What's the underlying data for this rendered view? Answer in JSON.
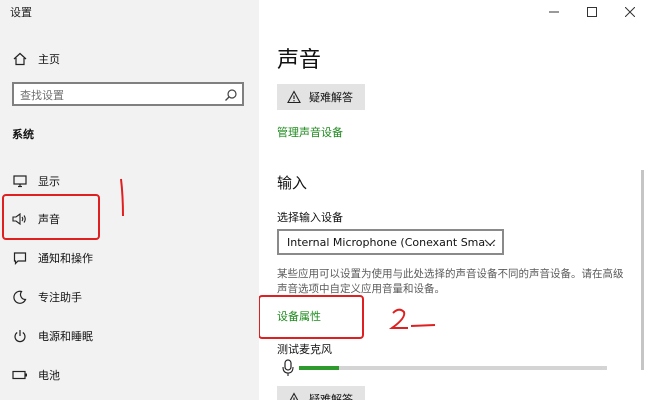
{
  "window": {
    "title": "设置",
    "controls": {
      "minimize": "—",
      "maximize": "□",
      "close": "✕"
    }
  },
  "sidebar": {
    "home_label": "主页",
    "search_placeholder": "查找设置",
    "section": "系统",
    "items": [
      {
        "label": "显示",
        "icon": "monitor-icon"
      },
      {
        "label": "声音",
        "icon": "speaker-icon"
      },
      {
        "label": "通知和操作",
        "icon": "notification-icon"
      },
      {
        "label": "专注助手",
        "icon": "moon-icon"
      },
      {
        "label": "电源和睡眠",
        "icon": "power-icon"
      },
      {
        "label": "电池",
        "icon": "battery-icon"
      }
    ]
  },
  "main": {
    "title": "声音",
    "troubleshoot_label": "疑难解答",
    "manage_devices_link": "管理声音设备",
    "input_section": "输入",
    "choose_input_label": "选择输入设备",
    "input_device_value": "Internal Microphone (Conexant Sma...",
    "description": "某些应用可以设置为使用与此处选择的声音设备不同的声音设备。请在高级声音选项中自定义应用音量和设备。",
    "device_properties_link": "设备属性",
    "test_mic_label": "测试麦克风",
    "mic_level": 0.13,
    "troubleshoot_label_2": "疑难解答"
  },
  "annotations": {
    "mark1": "1",
    "mark2": "2",
    "color": "#e02020"
  },
  "colors": {
    "link": "#1d8a1d",
    "sidebar_bg": "#f2f2f2",
    "button_bg": "#e3e3e3"
  }
}
